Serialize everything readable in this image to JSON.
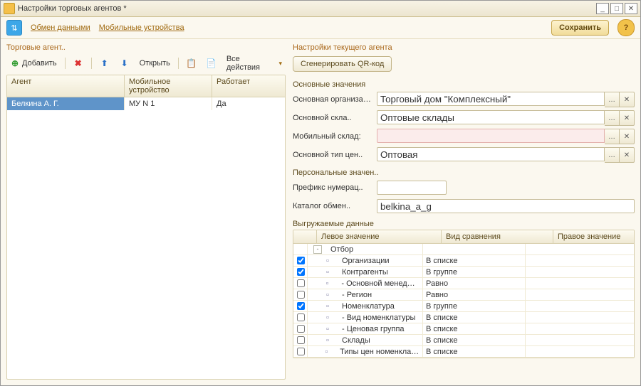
{
  "window": {
    "title": "Настройки торговых агентов *"
  },
  "topbar": {
    "link_exchange": "Обмен данными",
    "link_devices": "Мобильные устройства",
    "save": "Сохранить"
  },
  "left": {
    "title": "Торговые агент..",
    "toolbar": {
      "add": "Добавить",
      "open": "Открыть",
      "all_actions": "Все действия"
    },
    "grid": {
      "columns": {
        "agent": "Агент",
        "device": "Мобильное устройство",
        "works": "Работает"
      },
      "rows": [
        {
          "agent": "Белкина А. Г.",
          "device": "МУ N 1",
          "works": "Да"
        }
      ]
    }
  },
  "right": {
    "title": "Настройки текущего агента",
    "qr_btn": "Сгенерировать QR-код",
    "main_section": "Основные значения",
    "fields": {
      "org_label": "Основная организаци..",
      "org_value": "Торговый дом \"Комплексный\"",
      "warehouse_label": "Основной скла..",
      "warehouse_value": "Оптовые склады",
      "mobile_wh_label": "Мобильный склад:",
      "mobile_wh_value": "",
      "price_type_label": "Основной тип цен..",
      "price_type_value": "Оптовая"
    },
    "personal_section": "Персональные значен..",
    "prefix_label": "Префикс нумерац..",
    "prefix_value": "",
    "catalog_label": "Каталог обмен..",
    "catalog_value": "belkina_a_g",
    "export_section": "Выгружаемые данные",
    "xgrid": {
      "columns": {
        "check": "",
        "left": "Левое значение",
        "cmp": "Вид сравнения",
        "right": "Правое значение"
      },
      "rows": [
        {
          "indent": 0,
          "check": null,
          "toggle": "-",
          "label": "Отбор",
          "cmp": "",
          "right": ""
        },
        {
          "indent": 1,
          "check": true,
          "leaf": true,
          "label": "Организации",
          "cmp": "В списке",
          "right": ""
        },
        {
          "indent": 1,
          "check": true,
          "leaf": true,
          "label": "Контрагенты",
          "cmp": "В группе",
          "right": ""
        },
        {
          "indent": 1,
          "check": false,
          "leaf": true,
          "label": "- Основной менеджер",
          "cmp": "Равно",
          "right": ""
        },
        {
          "indent": 1,
          "check": false,
          "leaf": true,
          "label": "- Регион",
          "cmp": "Равно",
          "right": ""
        },
        {
          "indent": 1,
          "check": true,
          "leaf": true,
          "label": "Номенклатура",
          "cmp": "В группе",
          "right": ""
        },
        {
          "indent": 1,
          "check": false,
          "leaf": true,
          "label": "- Вид номенклатуры",
          "cmp": "В списке",
          "right": ""
        },
        {
          "indent": 1,
          "check": false,
          "leaf": true,
          "label": "- Ценовая группа",
          "cmp": "В списке",
          "right": ""
        },
        {
          "indent": 1,
          "check": false,
          "leaf": true,
          "label": "Склады",
          "cmp": "В списке",
          "right": ""
        },
        {
          "indent": 1,
          "check": false,
          "leaf": true,
          "label": "Типы цен номенклатур..",
          "cmp": "В списке",
          "right": ""
        }
      ]
    }
  }
}
